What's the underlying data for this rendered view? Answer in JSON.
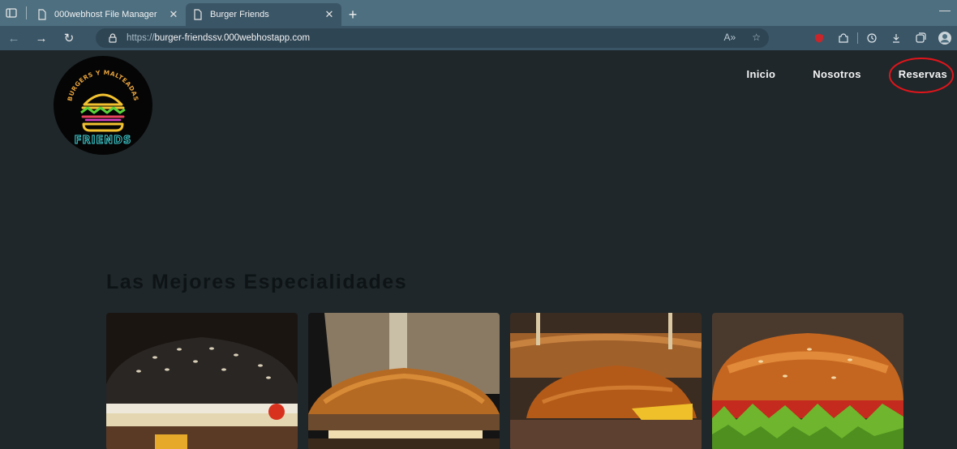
{
  "browser": {
    "tabs": [
      {
        "label": "000webhost File Manager",
        "active": false
      },
      {
        "label": "Burger Friends",
        "active": true
      }
    ],
    "url_protocol": "https://",
    "url_host": "burger-friendssv.000webhostapp.com",
    "icons": [
      "sidebar-icon",
      "page-icon",
      "close-icon",
      "plus-icon",
      "back-icon",
      "forward-icon",
      "refresh-icon",
      "lock-icon",
      "read-aloud-icon",
      "favorite-icon",
      "ublock-icon",
      "extensions-icon",
      "history-icon",
      "download-icon",
      "collections-icon",
      "profile-icon"
    ]
  },
  "site": {
    "logo_text_top": "BURGERS Y MALTEADAS",
    "logo_text_bottom": "FRIENDS",
    "nav": [
      "Inicio",
      "Nosotros",
      "Reservas"
    ],
    "highlighted_nav": "Reservas",
    "highlight_color": "#e0151b",
    "section_title": "Las Mejores Especialidades",
    "cards": [
      {
        "name": "black-bun-burger"
      },
      {
        "name": "classic-burger"
      },
      {
        "name": "skewered-burger"
      },
      {
        "name": "lettuce-tomato-burger"
      }
    ]
  }
}
